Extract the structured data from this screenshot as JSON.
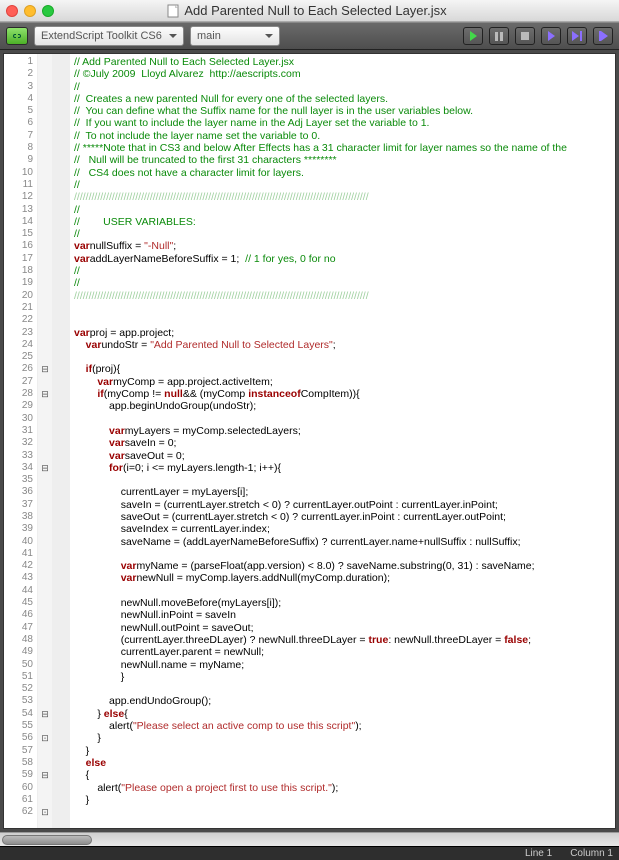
{
  "window": {
    "title": "Add Parented Null to Each Selected Layer.jsx"
  },
  "toolbar": {
    "target_combo": "ExtendScript Toolkit CS6",
    "engine_combo": "main"
  },
  "status": {
    "line": "Line 1",
    "col": "Column 1"
  },
  "fold_markers": {
    "26": "⊟",
    "28": "⊟",
    "34": "⊟",
    "54": "⊟",
    "56": "⊡",
    "59": "⊟",
    "62": "⊡"
  },
  "code_lines": [
    {
      "n": 1,
      "t": "cm",
      "s": "// Add Parented Null to Each Selected Layer.jsx"
    },
    {
      "n": 2,
      "t": "cm",
      "s": "// ©July 2009  Lloyd Alvarez  http://aescripts.com"
    },
    {
      "n": 3,
      "t": "cm",
      "s": "//"
    },
    {
      "n": 4,
      "t": "cm",
      "s": "//  Creates a new parented Null for every one of the selected layers."
    },
    {
      "n": 5,
      "t": "cm",
      "s": "//  You can define what the Suffix name for the null layer is in the user variables below."
    },
    {
      "n": 6,
      "t": "cm",
      "s": "//  If you want to include the layer name in the Adj Layer set the variable to 1."
    },
    {
      "n": 7,
      "t": "cm",
      "s": "//  To not include the layer name set the variable to 0."
    },
    {
      "n": 8,
      "t": "cm",
      "s": "// *****Note that in CS3 and below After Effects has a 31 character limit for layer names so the name of the"
    },
    {
      "n": 9,
      "t": "cm",
      "s": "//   Null will be truncated to the first 31 characters ********"
    },
    {
      "n": 10,
      "t": "cm",
      "s": "//   CS4 does not have a character limit for layers."
    },
    {
      "n": 11,
      "t": "cm",
      "s": "//"
    },
    {
      "n": 12,
      "t": "sep",
      "s": "/////////////////////////////////////////////////////////////////////////////////////////////////////"
    },
    {
      "n": 13,
      "t": "cm",
      "s": "//"
    },
    {
      "n": 14,
      "t": "cm",
      "s": "//        USER VARIABLES:"
    },
    {
      "n": 15,
      "t": "cm",
      "s": "//"
    },
    {
      "n": 16,
      "t": "code",
      "s": "var nullSuffix = \"-Null\";",
      "tok": [
        "kw:var",
        " id:nullSuffix ",
        "op:= ",
        "str:\"-Null\"",
        "op:;"
      ]
    },
    {
      "n": 17,
      "t": "code",
      "s": "var addLayerNameBeforeSuffix = 1;  // 1 for yes, 0 for no",
      "tok": [
        "kw:var",
        " id:addLayerNameBeforeSuffix ",
        "op:= ",
        "num:1",
        "op:;  ",
        "cm:// 1 for yes, 0 for no"
      ]
    },
    {
      "n": 18,
      "t": "cm",
      "s": "//"
    },
    {
      "n": 19,
      "t": "cm",
      "s": "//"
    },
    {
      "n": 20,
      "t": "sep",
      "s": "/////////////////////////////////////////////////////////////////////////////////////////////////////"
    },
    {
      "n": 21,
      "t": "blank",
      "s": ""
    },
    {
      "n": 22,
      "t": "blank",
      "s": ""
    },
    {
      "n": 23,
      "t": "code",
      "tok": [
        "kw:var",
        " id:proj ",
        "op:= ",
        "id:app.project",
        "op:;"
      ]
    },
    {
      "n": 24,
      "t": "code",
      "tok": [
        "pad:    ",
        "kw:var",
        " id:undoStr ",
        "op:= ",
        "str:\"Add Parented Null to Selected Layers\"",
        "op:;"
      ]
    },
    {
      "n": 25,
      "t": "blank",
      "s": ""
    },
    {
      "n": 26,
      "t": "code",
      "tok": [
        "pad:    ",
        "kw:if",
        " op:(",
        "id:proj",
        "op:){"
      ]
    },
    {
      "n": 27,
      "t": "code",
      "tok": [
        "pad:        ",
        "kw:var",
        " id:myComp ",
        "op:= ",
        "id:app.project.activeItem",
        "op:;"
      ]
    },
    {
      "n": 28,
      "t": "code",
      "tok": [
        "pad:        ",
        "kw:if",
        " op:(",
        "id:myComp ",
        "op:!= ",
        "kw:null",
        " op:&& (",
        "id:myComp ",
        "kw:instanceof",
        " id:CompItem",
        "op:)){"
      ]
    },
    {
      "n": 29,
      "t": "code",
      "tok": [
        "pad:            ",
        "id:app.beginUndoGroup(undoStr);"
      ]
    },
    {
      "n": 30,
      "t": "blank",
      "s": ""
    },
    {
      "n": 31,
      "t": "code",
      "tok": [
        "pad:            ",
        "kw:var",
        " id:myLayers ",
        "op:= ",
        "id:myComp.selectedLayers",
        "op:;"
      ]
    },
    {
      "n": 32,
      "t": "code",
      "tok": [
        "pad:            ",
        "kw:var",
        " id:saveIn ",
        "op:= ",
        "num:0",
        "op:;"
      ]
    },
    {
      "n": 33,
      "t": "code",
      "tok": [
        "pad:            ",
        "kw:var",
        " id:saveOut ",
        "op:= ",
        "num:0",
        "op:;"
      ]
    },
    {
      "n": 34,
      "t": "code",
      "tok": [
        "pad:            ",
        "kw:for",
        " op:(",
        "id:i",
        "op:=",
        "num:0",
        "op:; ",
        "id:i ",
        "op:<= ",
        "id:myLayers.length",
        "op:-",
        "num:1",
        "op:; ",
        "id:i",
        "op:++",
        "op:){"
      ]
    },
    {
      "n": 35,
      "t": "blank",
      "s": ""
    },
    {
      "n": 36,
      "t": "code",
      "tok": [
        "pad:                ",
        "id:currentLayer ",
        "op:= ",
        "id:myLayers[i]",
        "op:;"
      ]
    },
    {
      "n": 37,
      "t": "code",
      "tok": [
        "pad:                ",
        "id:saveIn ",
        "op:= (",
        "id:currentLayer.stretch ",
        "op:< ",
        "num:0",
        "op:) ? ",
        "id:currentLayer.outPoint ",
        "op:: ",
        "id:currentLayer.inPoint",
        "op:;"
      ]
    },
    {
      "n": 38,
      "t": "code",
      "tok": [
        "pad:                ",
        "id:saveOut ",
        "op:= (",
        "id:currentLayer.stretch ",
        "op:< ",
        "num:0",
        "op:) ? ",
        "id:currentLayer.inPoint ",
        "op:: ",
        "id:currentLayer.outPoint",
        "op:;"
      ]
    },
    {
      "n": 39,
      "t": "code",
      "tok": [
        "pad:                ",
        "id:saveIndex ",
        "op:= ",
        "id:currentLayer.index",
        "op:;"
      ]
    },
    {
      "n": 40,
      "t": "code",
      "tok": [
        "pad:                ",
        "id:saveName ",
        "op:= (",
        "id:addLayerNameBeforeSuffix",
        "op:) ? ",
        "id:currentLayer.name",
        "op:+",
        "id:nullSuffix ",
        "op:: ",
        "id:nullSuffix",
        "op:;"
      ]
    },
    {
      "n": 41,
      "t": "blank",
      "s": ""
    },
    {
      "n": 42,
      "t": "code",
      "tok": [
        "pad:                ",
        "kw:var",
        " id:myName ",
        "op:= (",
        "id:parseFloat(app.version) ",
        "op:< ",
        "num:8.0",
        "op:) ? ",
        "id:saveName.substring(",
        "num:0",
        "op:, ",
        "num:31",
        "op:) : ",
        "id:saveName",
        "op:;"
      ]
    },
    {
      "n": 43,
      "t": "code",
      "tok": [
        "pad:                ",
        "kw:var",
        " id:newNull ",
        "op:= ",
        "id:myComp.layers.addNull(myComp.duration)",
        "op:;"
      ]
    },
    {
      "n": 44,
      "t": "blank",
      "s": ""
    },
    {
      "n": 45,
      "t": "code",
      "tok": [
        "pad:                ",
        "id:newNull.moveBefore(myLayers[i])",
        "op:;"
      ]
    },
    {
      "n": 46,
      "t": "code",
      "tok": [
        "pad:                ",
        "id:newNull.inPoint ",
        "op:= ",
        "id:saveIn"
      ]
    },
    {
      "n": 47,
      "t": "code",
      "tok": [
        "pad:                ",
        "id:newNull.outPoint ",
        "op:= ",
        "id:saveOut",
        "op:;"
      ]
    },
    {
      "n": 48,
      "t": "code",
      "tok": [
        "pad:                ",
        "op:(",
        "id:currentLayer.threeDLayer",
        "op:) ? ",
        "id:newNull.threeDLayer ",
        "op:= ",
        "kw:true",
        " op:: ",
        "id:newNull.threeDLayer ",
        "op:= ",
        "kw:false",
        "op:;"
      ]
    },
    {
      "n": 49,
      "t": "code",
      "tok": [
        "pad:                ",
        "id:currentLayer.parent ",
        "op:= ",
        "id:newNull",
        "op:;"
      ]
    },
    {
      "n": 50,
      "t": "code",
      "tok": [
        "pad:                ",
        "id:newNull.name ",
        "op:= ",
        "id:myName",
        "op:;"
      ]
    },
    {
      "n": 51,
      "t": "code",
      "tok": [
        "pad:                ",
        "op:}"
      ]
    },
    {
      "n": 52,
      "t": "blank",
      "s": ""
    },
    {
      "n": 53,
      "t": "code",
      "tok": [
        "pad:            ",
        "id:app.endUndoGroup()",
        "op:;"
      ]
    },
    {
      "n": 54,
      "t": "code",
      "tok": [
        "pad:        ",
        "op:} ",
        "kw:else",
        " op:{"
      ]
    },
    {
      "n": 55,
      "t": "code",
      "tok": [
        "pad:            ",
        "id:alert(",
        "str:\"Please select an active comp to use this script\"",
        "op:);"
      ]
    },
    {
      "n": 56,
      "t": "code",
      "tok": [
        "pad:        ",
        "op:}"
      ]
    },
    {
      "n": 57,
      "t": "code",
      "tok": [
        "pad:    ",
        "op:}"
      ]
    },
    {
      "n": 58,
      "t": "code",
      "tok": [
        "pad:    ",
        "kw:else"
      ]
    },
    {
      "n": 59,
      "t": "code",
      "tok": [
        "pad:    ",
        "op:{"
      ]
    },
    {
      "n": 60,
      "t": "code",
      "tok": [
        "pad:        ",
        "id:alert(",
        "str:\"Please open a project first to use this script.\"",
        "op:);"
      ]
    },
    {
      "n": 61,
      "t": "code",
      "tok": [
        "pad:    ",
        "op:}"
      ]
    },
    {
      "n": 62,
      "t": "blank",
      "s": ""
    }
  ]
}
